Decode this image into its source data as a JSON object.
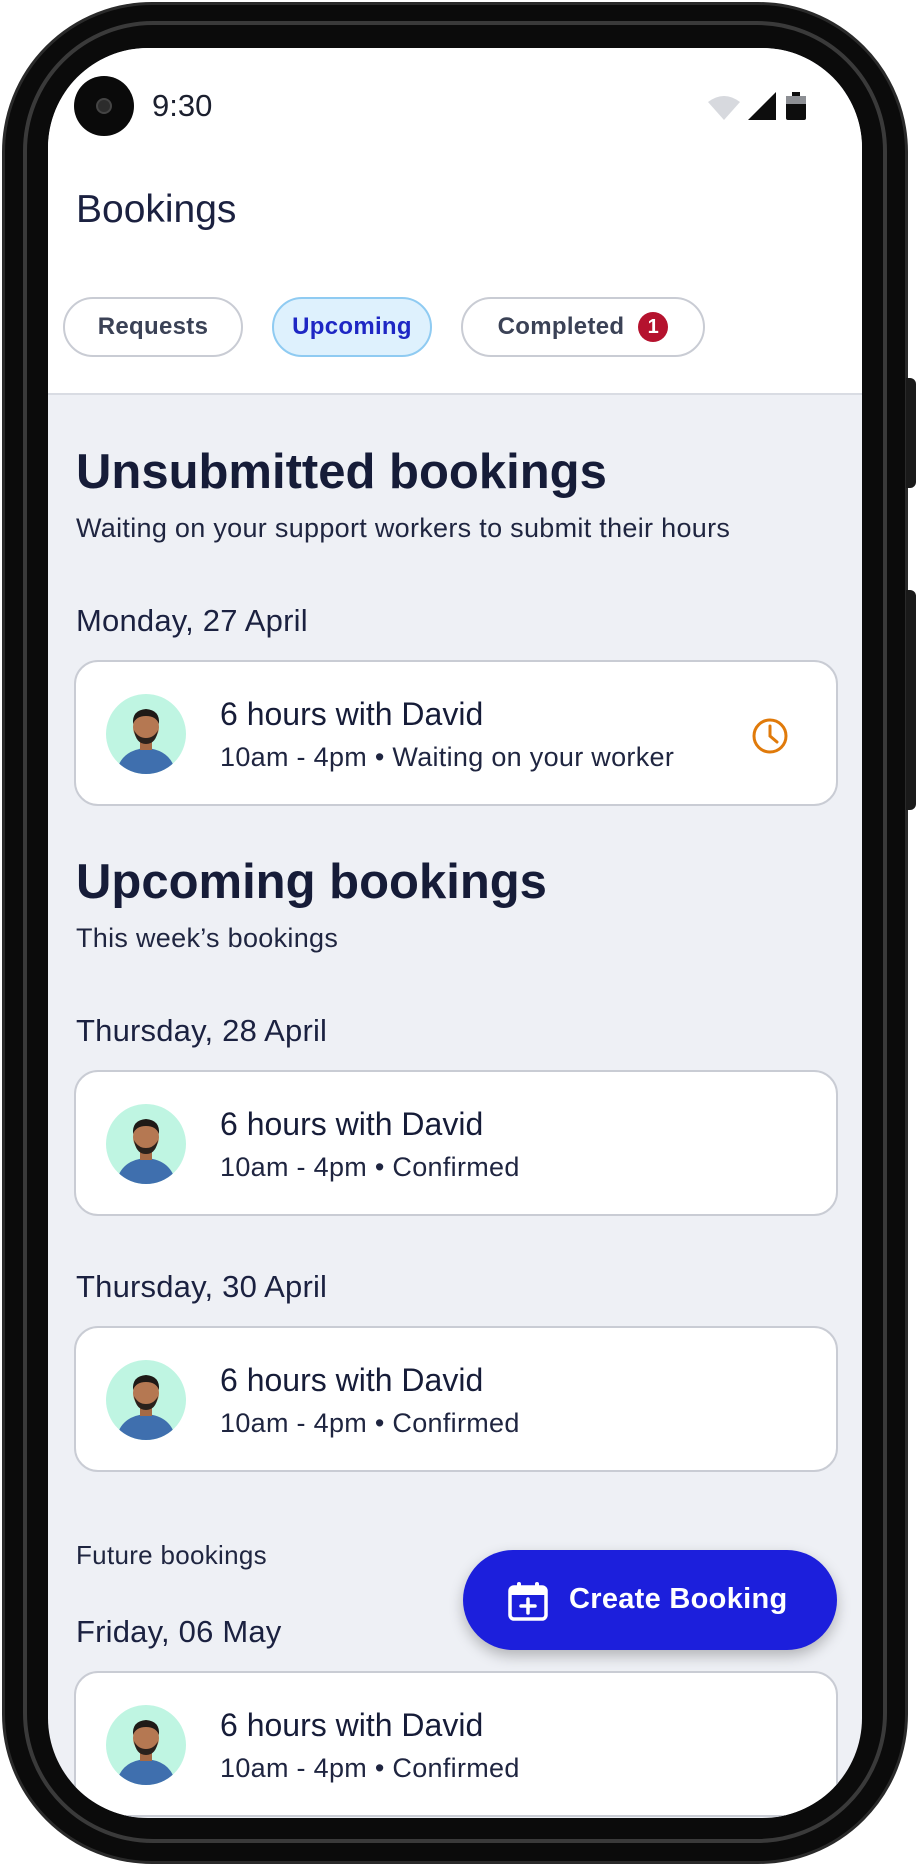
{
  "status_bar": {
    "time": "9:30"
  },
  "header": {
    "title": "Bookings"
  },
  "tabs": [
    {
      "label": "Requests"
    },
    {
      "label": "Upcoming"
    },
    {
      "label": "Completed",
      "badge": "1"
    }
  ],
  "unsubmitted": {
    "heading": "Unsubmitted bookings",
    "subheading": "Waiting on your support workers to submit their hours",
    "groups": [
      {
        "date": "Monday, 27 April",
        "title": "6 hours with David",
        "detail": "10am - 4pm • Waiting on your worker",
        "status_icon": "clock-icon"
      }
    ]
  },
  "upcoming": {
    "heading": "Upcoming bookings",
    "subheading": "This week’s bookings",
    "groups": [
      {
        "date": "Thursday, 28 April",
        "title": "6 hours with David",
        "detail": "10am - 4pm • Confirmed"
      },
      {
        "date": "Thursday, 30 April",
        "title": "6 hours with David",
        "detail": "10am - 4pm • Confirmed"
      }
    ]
  },
  "future": {
    "label": "Future bookings",
    "groups": [
      {
        "date": "Friday, 06 May",
        "title": "6 hours with David",
        "detail": "10am - 4pm • Confirmed"
      }
    ]
  },
  "fab": {
    "label": "Create Booking",
    "icon": "calendar-plus-icon"
  },
  "colors": {
    "accent": "#1c1fdc",
    "active_tab_bg": "#def1fd",
    "badge": "#b5122e",
    "warning": "#e07a0a"
  }
}
